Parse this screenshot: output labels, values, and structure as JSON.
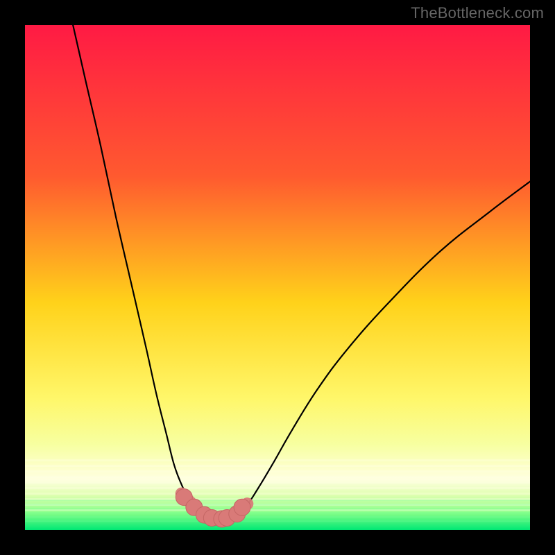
{
  "watermark": "TheBottleneck.com",
  "colors": {
    "frame": "#000000",
    "gradient_top": "#ff1a44",
    "gradient_mid1": "#ff7a2a",
    "gradient_mid2": "#ffd21a",
    "gradient_mid3": "#fff76a",
    "gradient_mid4": "#d7ff6a",
    "gradient_bottom": "#00e874",
    "curve": "#000000",
    "marker_fill": "#d97a78",
    "marker_stroke": "#c46664"
  },
  "chart_data": {
    "type": "line",
    "title": "",
    "xlabel": "",
    "ylabel": "",
    "xlim": [
      0,
      100
    ],
    "ylim": [
      0,
      100
    ],
    "grid": false,
    "legend": false,
    "series": [
      {
        "name": "left-arm",
        "x": [
          9.5,
          12,
          15,
          18,
          21,
          24,
          26,
          28,
          29.5,
          31,
          32.5,
          34,
          36
        ],
        "y": [
          100,
          89,
          76,
          62,
          49,
          36,
          27,
          19,
          13,
          9,
          6,
          4,
          2.5
        ]
      },
      {
        "name": "right-arm",
        "x": [
          42,
          44,
          46,
          49,
          53,
          58,
          64,
          72,
          82,
          92,
          100
        ],
        "y": [
          3,
          5,
          8,
          13,
          20,
          28,
          36,
          45,
          55,
          63,
          69
        ]
      }
    ],
    "valley_points": {
      "x": [
        31.5,
        33.5,
        35.5,
        37,
        39,
        40,
        42,
        43
      ],
      "y": [
        6.5,
        4.5,
        3,
        2.4,
        2.2,
        2.4,
        3.2,
        4.5
      ]
    },
    "valley_segments": [
      {
        "x": [
          31,
          34
        ],
        "y": [
          7.2,
          4.2
        ]
      },
      {
        "x": [
          35.5,
          40.5
        ],
        "y": [
          2.6,
          2.4
        ]
      },
      {
        "x": [
          41,
          44
        ],
        "y": [
          2.8,
          5.2
        ]
      }
    ]
  }
}
